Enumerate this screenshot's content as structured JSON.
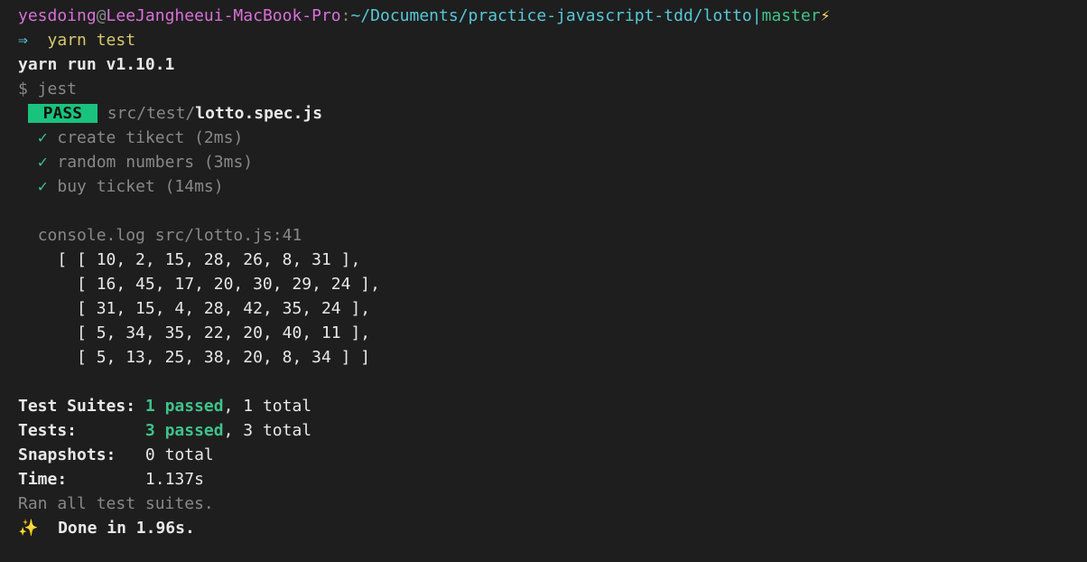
{
  "prompt": {
    "user": "yesdoing",
    "at": "@",
    "host": "LeeJangheeui-MacBook-Pro",
    "colon": ":",
    "path": "~/Documents/practice-javascript-tdd/lotto",
    "pipe": "|",
    "branch": "master",
    "lightning": "⚡",
    "arrow": "⇒",
    "command": "yarn test"
  },
  "yarn_run": "yarn run v1.10.1",
  "jest_cmd": "$ jest",
  "pass_badge": " PASS ",
  "test_file_dir": "src/test/",
  "test_file_name": "lotto.spec.js",
  "tests": {
    "t1": "create tikect (2ms)",
    "t2": "random numbers (3ms)",
    "t3": "buy ticket (14ms)"
  },
  "console_log_header": "console.log src/lotto.js:41",
  "log_lines": {
    "l1": "[ [ 10, 2, 15, 28, 26, 8, 31 ],",
    "l2": "  [ 16, 45, 17, 20, 30, 29, 24 ],",
    "l3": "  [ 31, 15, 4, 28, 42, 35, 24 ],",
    "l4": "  [ 5, 34, 35, 22, 20, 40, 11 ],",
    "l5": "  [ 5, 13, 25, 38, 20, 8, 34 ] ]"
  },
  "summary": {
    "suites_label": "Test Suites: ",
    "suites_passed": "1 passed",
    "suites_rest": ", 1 total",
    "tests_label": "Tests:       ",
    "tests_passed": "3 passed",
    "tests_rest": ", 3 total",
    "snapshots_label": "Snapshots:   ",
    "snapshots_val": "0 total",
    "time_label": "Time:        ",
    "time_val": "1.137s",
    "ran_all": "Ran all test suites.",
    "sparkle": "✨",
    "done": "  Done in 1.96s."
  }
}
